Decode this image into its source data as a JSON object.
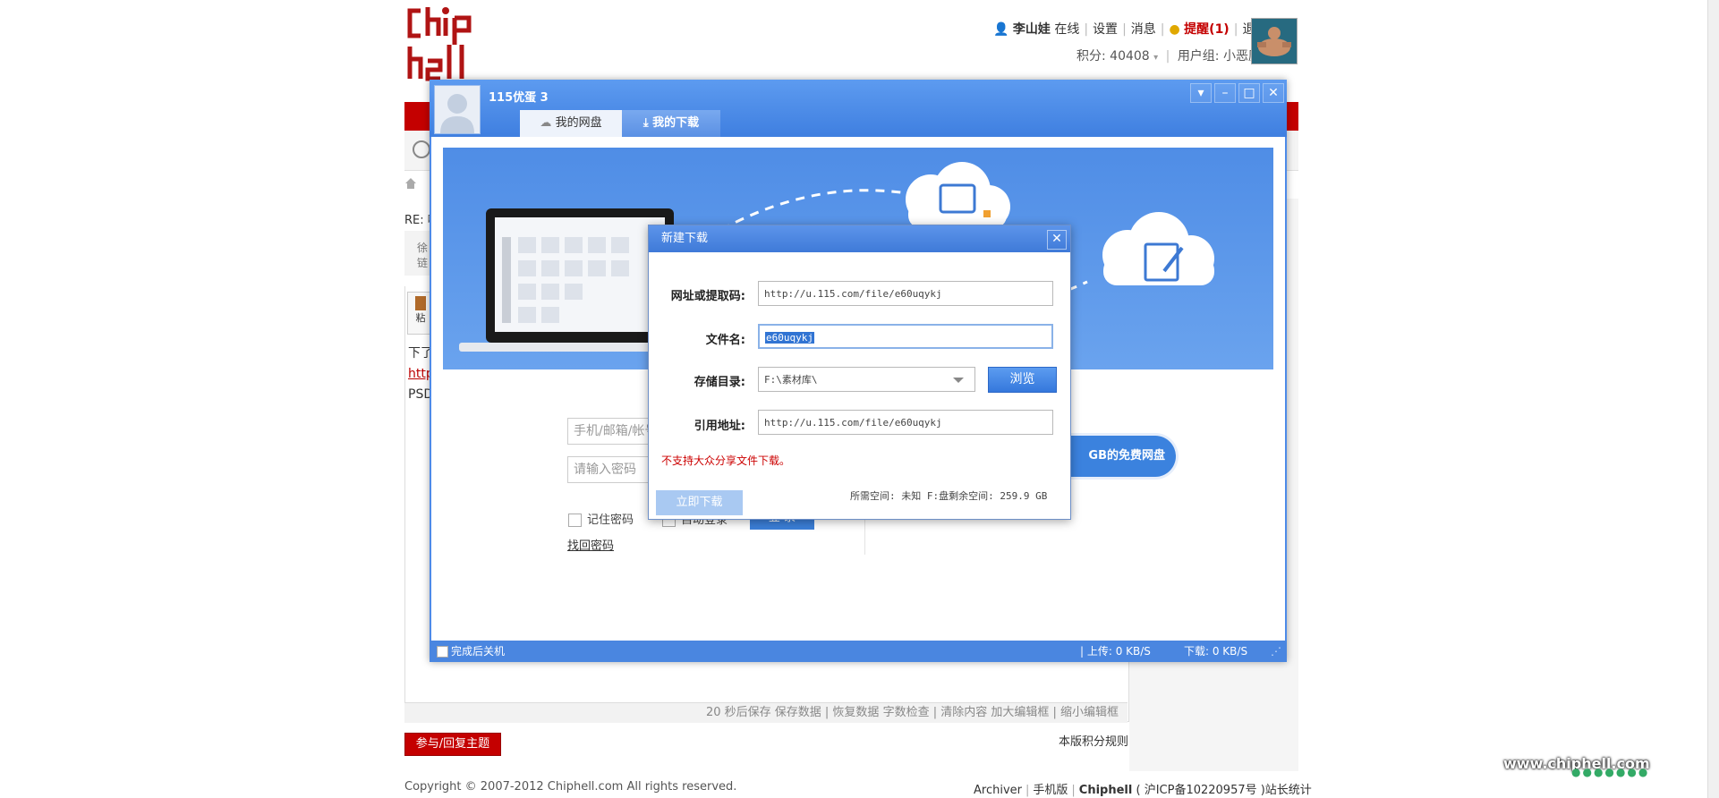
{
  "forum": {
    "user": {
      "name": "李山娃",
      "status": "在线",
      "settings": "设置",
      "messages": "消息",
      "alerts": "提醒(1)",
      "logout": "退出",
      "points": "积分: 40408",
      "group": "用户组: 小恶魔"
    },
    "post": {
      "re_title": "RE: 唧",
      "quote_line1": "徐",
      "quote_line2": "链",
      "paste_label": "粘",
      "body_line1": "下了",
      "body_line2": "http",
      "body_line3": "PSD"
    },
    "editor_footer": "20 秒后保存 保存数据 | 恢复数据   字数检查 | 清除内容   加大编辑框 | 缩小编辑框",
    "reply_button": "参与/回复主题",
    "score_rules": "本版积分规则",
    "copyright": "Copyright © 2007-2012 Chiphell.com All rights reserved.",
    "footer_links": [
      "Archiver",
      "手机版",
      "Chiphell",
      "( 沪ICP备10220957号 )站长统计"
    ],
    "watermark": "www.chiphell.com"
  },
  "client": {
    "title": "115优蛋  3",
    "tabs": [
      {
        "label": "我的网盘",
        "icon": "cloud-icon",
        "active": true
      },
      {
        "label": "我的下载",
        "icon": "download-icon",
        "active": false
      }
    ],
    "controls": {
      "dropdown": "▾",
      "minimize": "–",
      "maximize": "□",
      "close": "✕"
    },
    "login": {
      "account_placeholder": "手机/邮箱/帐号",
      "password_placeholder": "请输入密码",
      "remember": "记住密码",
      "auto_login": "自动登录",
      "login_button": "登  录",
      "forgot": "找回密码",
      "free_disk_button": "GB的免费网盘"
    },
    "status": {
      "shutdown": "完成后关机",
      "upload": "上传: 0 KB/S",
      "download": "下载: 0 KB/S"
    }
  },
  "dialog": {
    "title": "新建下载",
    "close": "✕",
    "url_label": "网址或提取码:",
    "url_value": "http://u.115.com/file/e60uqykj",
    "filename_label": "文件名:",
    "filename_value": "e60uqykj",
    "dir_label": "存储目录:",
    "dir_value": "F:\\素材库\\",
    "browse_button": "浏览",
    "ref_label": "引用地址:",
    "ref_value": "http://u.115.com/file/e60uqykj",
    "error": "不支持大众分享文件下载。",
    "download_now": "立即下载",
    "space_info": "所需空间: 未知  F:盘剩余空间: 259.9 GB"
  },
  "colors": {
    "forum_red": "#c40000",
    "client_blue": "#4d8ae8",
    "error_red": "#cc0000"
  }
}
